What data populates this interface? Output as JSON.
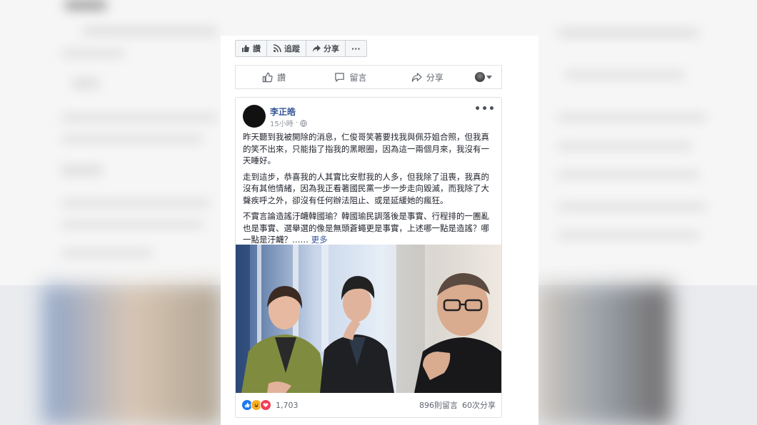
{
  "toolbar": {
    "like_label": "讚",
    "follow_label": "追蹤",
    "share_label": "分享",
    "more_label": "···"
  },
  "actions": {
    "like_label": "讚",
    "comment_label": "留言",
    "share_label": "分享"
  },
  "post": {
    "author": "李正皓",
    "time": "15小時",
    "menu_label": "•••",
    "paragraphs": [
      "昨天聽到我被開除的消息，仁俊哥笑著要找我與佩芬姐合照，但我真的笑不出來，只能指了指我的黑眼圈，因為這一兩個月來，我沒有一天睡好。",
      "走到這步，恭喜我的人其實比安慰我的人多，但我除了沮喪，我真的沒有其他情緒，因為我正看著國民黨一步一步走向毀滅，而我除了大聲疾呼之外，卻沒有任何辦法阻止、或是延緩她的瘋狂。",
      "不實言論造謠汙衊韓國瑜？韓國瑜民調落後是事實、行程排的一團亂也是事實、選舉選的像是無頭蒼蠅更是事實，上述哪一點是造謠？哪一點是汙衊？……"
    ],
    "see_more": "更多",
    "reaction_count": "1,703",
    "comments": "896則留言",
    "shares": "60次分享"
  },
  "colors": {
    "link": "#385898",
    "like_blue": "#1877f2",
    "haha_yellow": "#f7b125",
    "love_red": "#f33e58"
  }
}
